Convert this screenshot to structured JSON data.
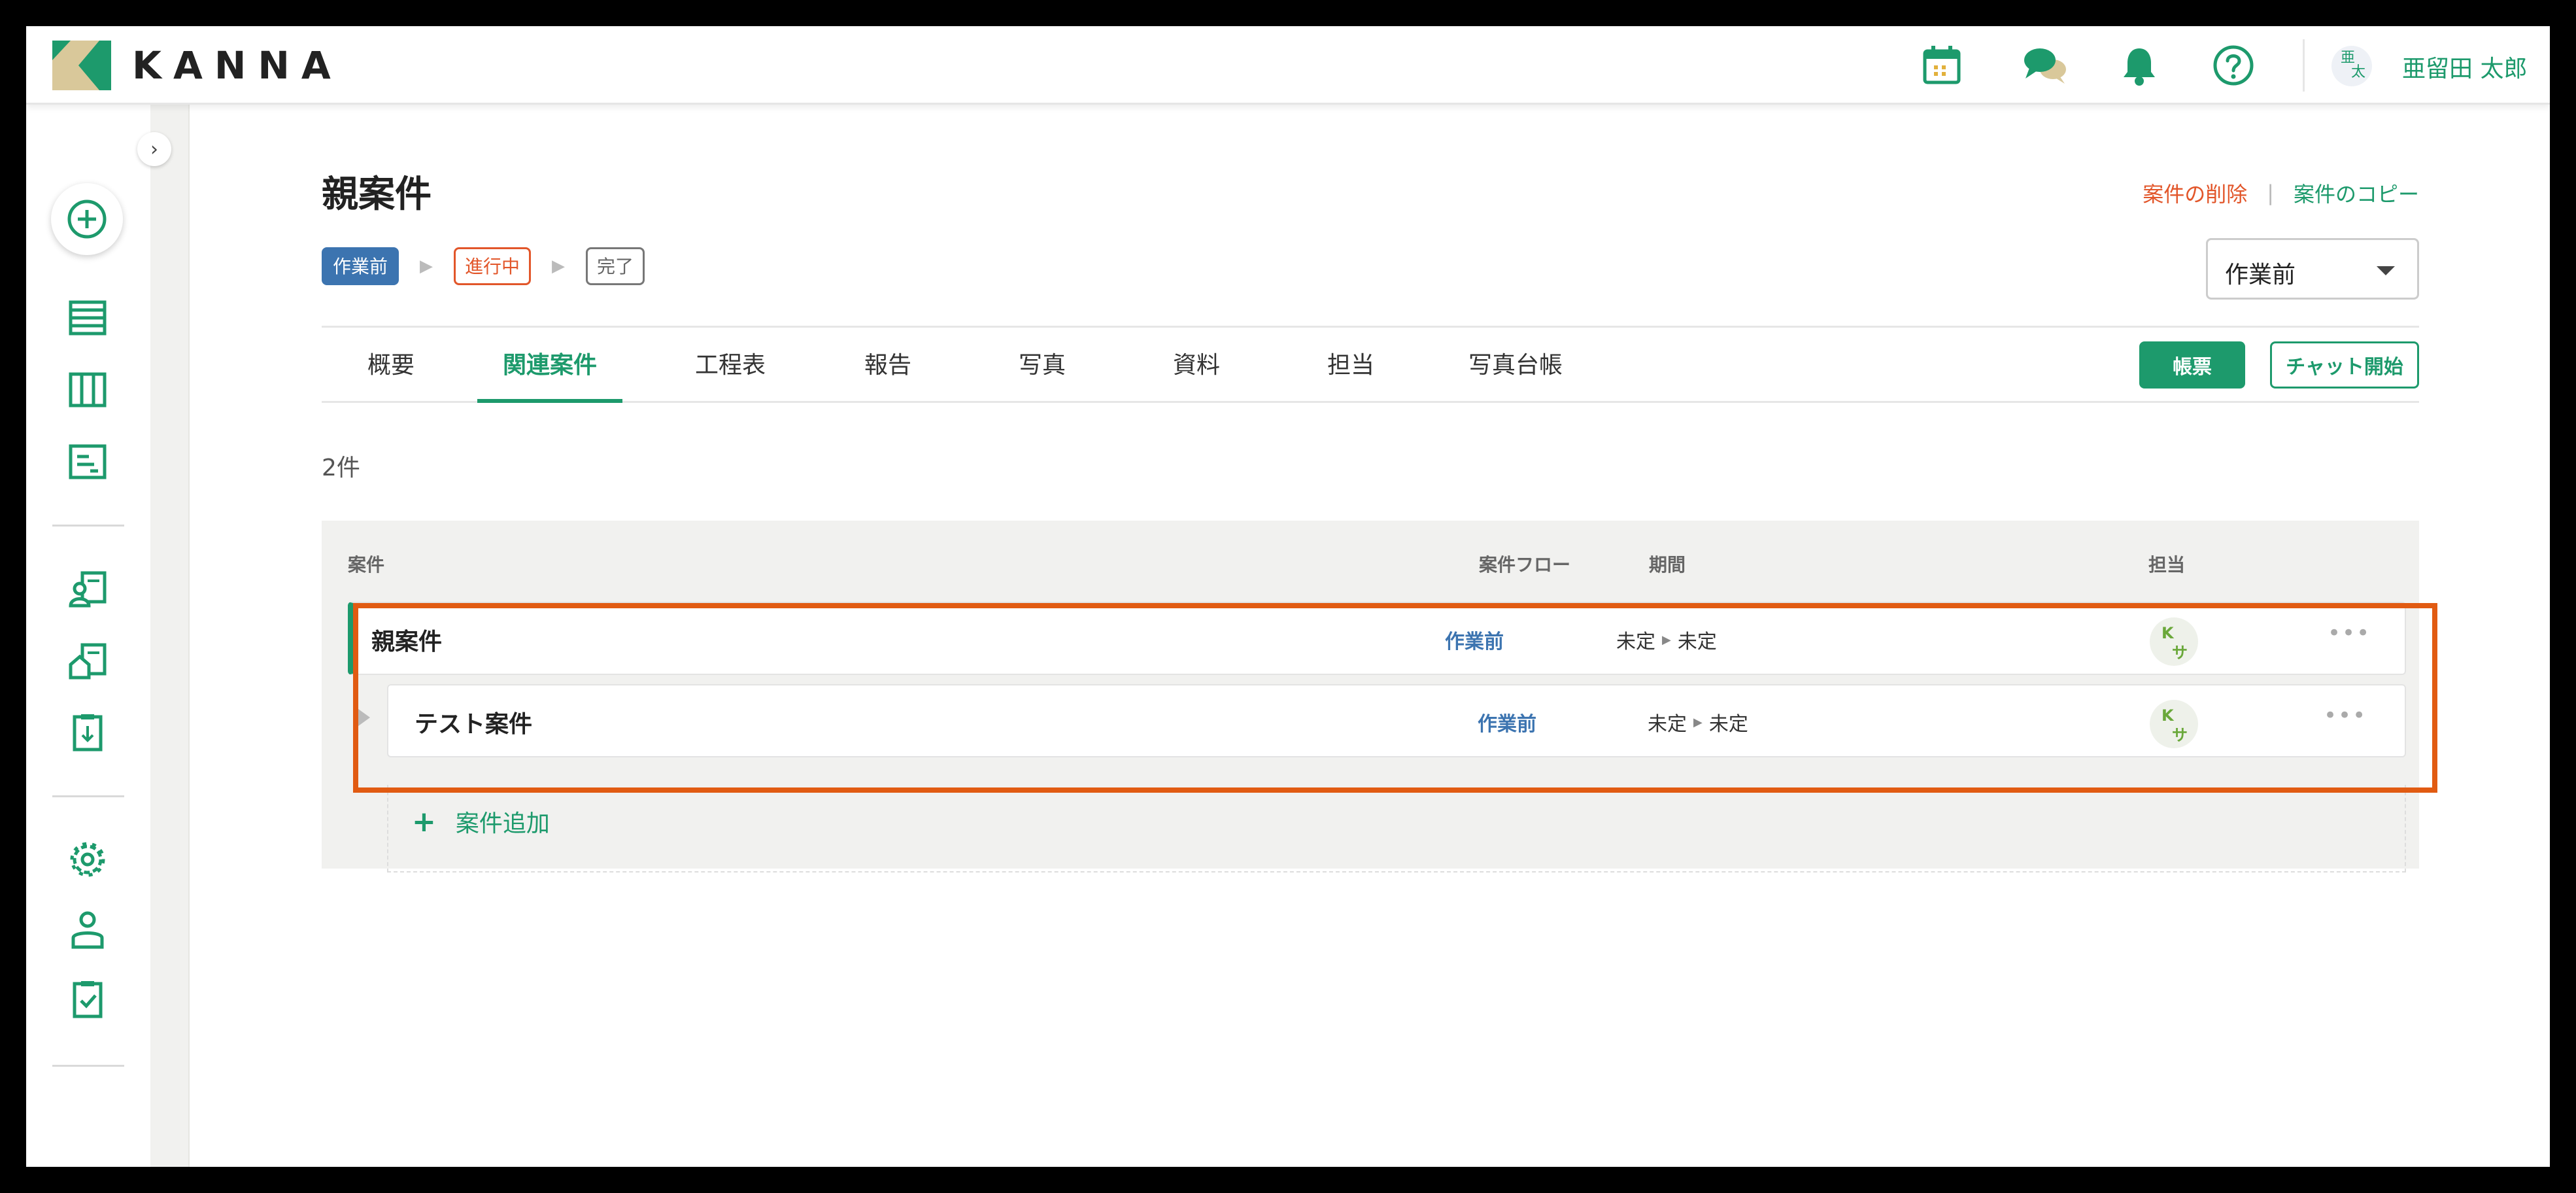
{
  "app": {
    "logo_text": "KANNA",
    "user": {
      "avatar_text_top": "亜",
      "avatar_text_bottom": "太",
      "name": "亜留田 太郎"
    },
    "header_icons": [
      "calendar-icon",
      "chat-icon",
      "bell-icon",
      "help-icon"
    ]
  },
  "sidebar": {
    "collapse_glyph": "›",
    "icons": [
      "add-icon",
      "list-icon",
      "board-icon",
      "report-icon",
      "project-person-icon",
      "project-house-icon",
      "download-clipboard-icon",
      "gear-icon",
      "user-icon",
      "checklist-icon"
    ]
  },
  "page": {
    "title": "親案件",
    "actions": {
      "delete": "案件の削除",
      "separator": "|",
      "copy": "案件のコピー"
    },
    "flow_steps": [
      "作業前",
      "進行中",
      "完了"
    ],
    "status_select": {
      "value": "作業前"
    },
    "tabs": [
      "概要",
      "関連案件",
      "工程表",
      "報告",
      "写真",
      "資料",
      "担当",
      "写真台帳"
    ],
    "active_tab": "関連案件",
    "buttons": {
      "report": "帳票",
      "chat_start": "チャット開始"
    },
    "count": "2件"
  },
  "table": {
    "headers": {
      "case": "案件",
      "flow": "案件フロー",
      "period": "期間",
      "assignee": "担当"
    },
    "rows": [
      {
        "name": "親案件",
        "flow": "作業前",
        "period_start": "未定",
        "period_end": "未定",
        "assignee_top": "K",
        "assignee_bottom": "サ"
      },
      {
        "name": "テスト案件",
        "flow": "作業前",
        "period_start": "未定",
        "period_end": "未定",
        "assignee_top": "K",
        "assignee_bottom": "サ"
      }
    ],
    "add_case_label": "案件追加",
    "more_glyph": "•••"
  },
  "colors": {
    "brand_green": "#1d9a6c",
    "flow_blue": "#3c74b0",
    "danger_orange": "#e2562a",
    "highlight_orange": "#e15b12"
  }
}
